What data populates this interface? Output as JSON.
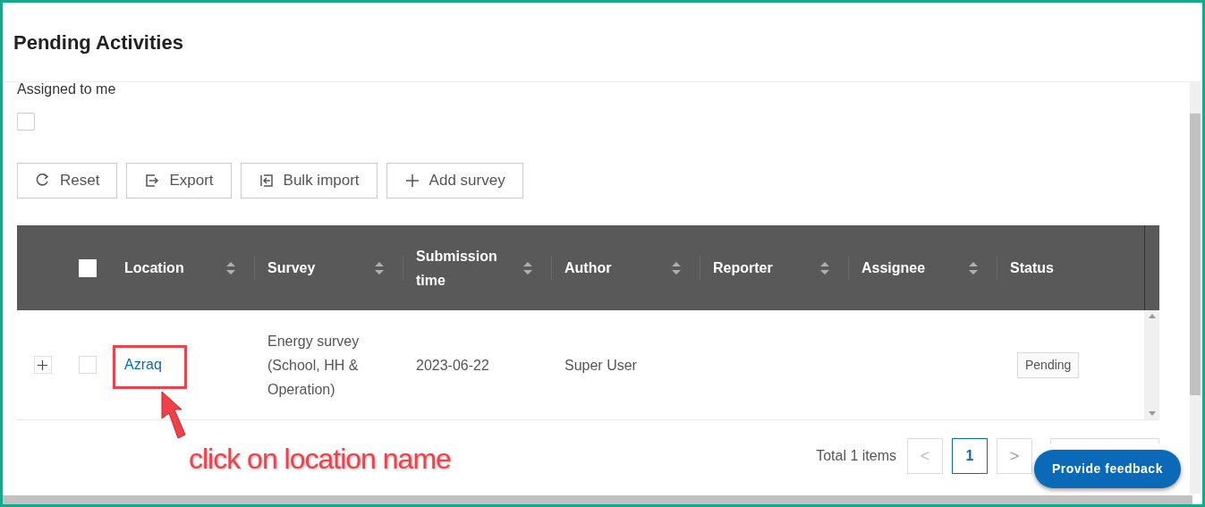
{
  "title": "Pending Activities",
  "filters": [
    {
      "label": "Assigned to me",
      "checked": false
    }
  ],
  "toolbar": [
    {
      "label": "Reset",
      "kind": "reset"
    },
    {
      "label": "Export",
      "kind": "export"
    },
    {
      "label": "Bulk import",
      "kind": "import"
    },
    {
      "label": "Add survey",
      "kind": "add"
    }
  ],
  "table": {
    "select_all_checked": false,
    "columns": [
      {
        "label": "Location",
        "sortable": true
      },
      {
        "label": "Survey",
        "sortable": true
      },
      {
        "label": "Submission time",
        "sortable": true
      },
      {
        "label": "Author",
        "sortable": true
      },
      {
        "label": "Reporter",
        "sortable": true
      },
      {
        "label": "Assignee",
        "sortable": true
      },
      {
        "label": "Status",
        "sortable": false
      }
    ],
    "rows": [
      {
        "expanded": false,
        "checked": false,
        "location": "Azraq",
        "survey": "Energy survey (School, HH & Operation)",
        "submission_time": "2023-06-22",
        "author": "Super User",
        "status": "Pending"
      }
    ]
  },
  "pagination": {
    "total": "Total 1 items",
    "prev": "<",
    "next": ">",
    "pages": [
      {
        "label": "1",
        "selected": true
      }
    ]
  },
  "feedback_button": "Provide feedback",
  "annotation": {
    "text": "click on location name"
  }
}
